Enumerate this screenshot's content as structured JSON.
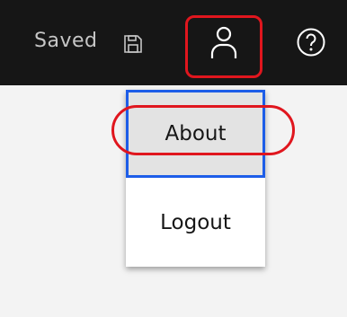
{
  "header": {
    "status_text": "Saved",
    "save_icon": "save-icon",
    "user_icon": "user-icon",
    "help_icon": "help-icon"
  },
  "user_menu": {
    "items": [
      {
        "label": "About",
        "state": "hover-focused"
      },
      {
        "label": "Logout"
      }
    ]
  },
  "colors": {
    "header_bg": "#161616",
    "page_bg": "#f3f3f3",
    "focus_outline": "#1d5de8",
    "annotation": "#e0161e"
  }
}
